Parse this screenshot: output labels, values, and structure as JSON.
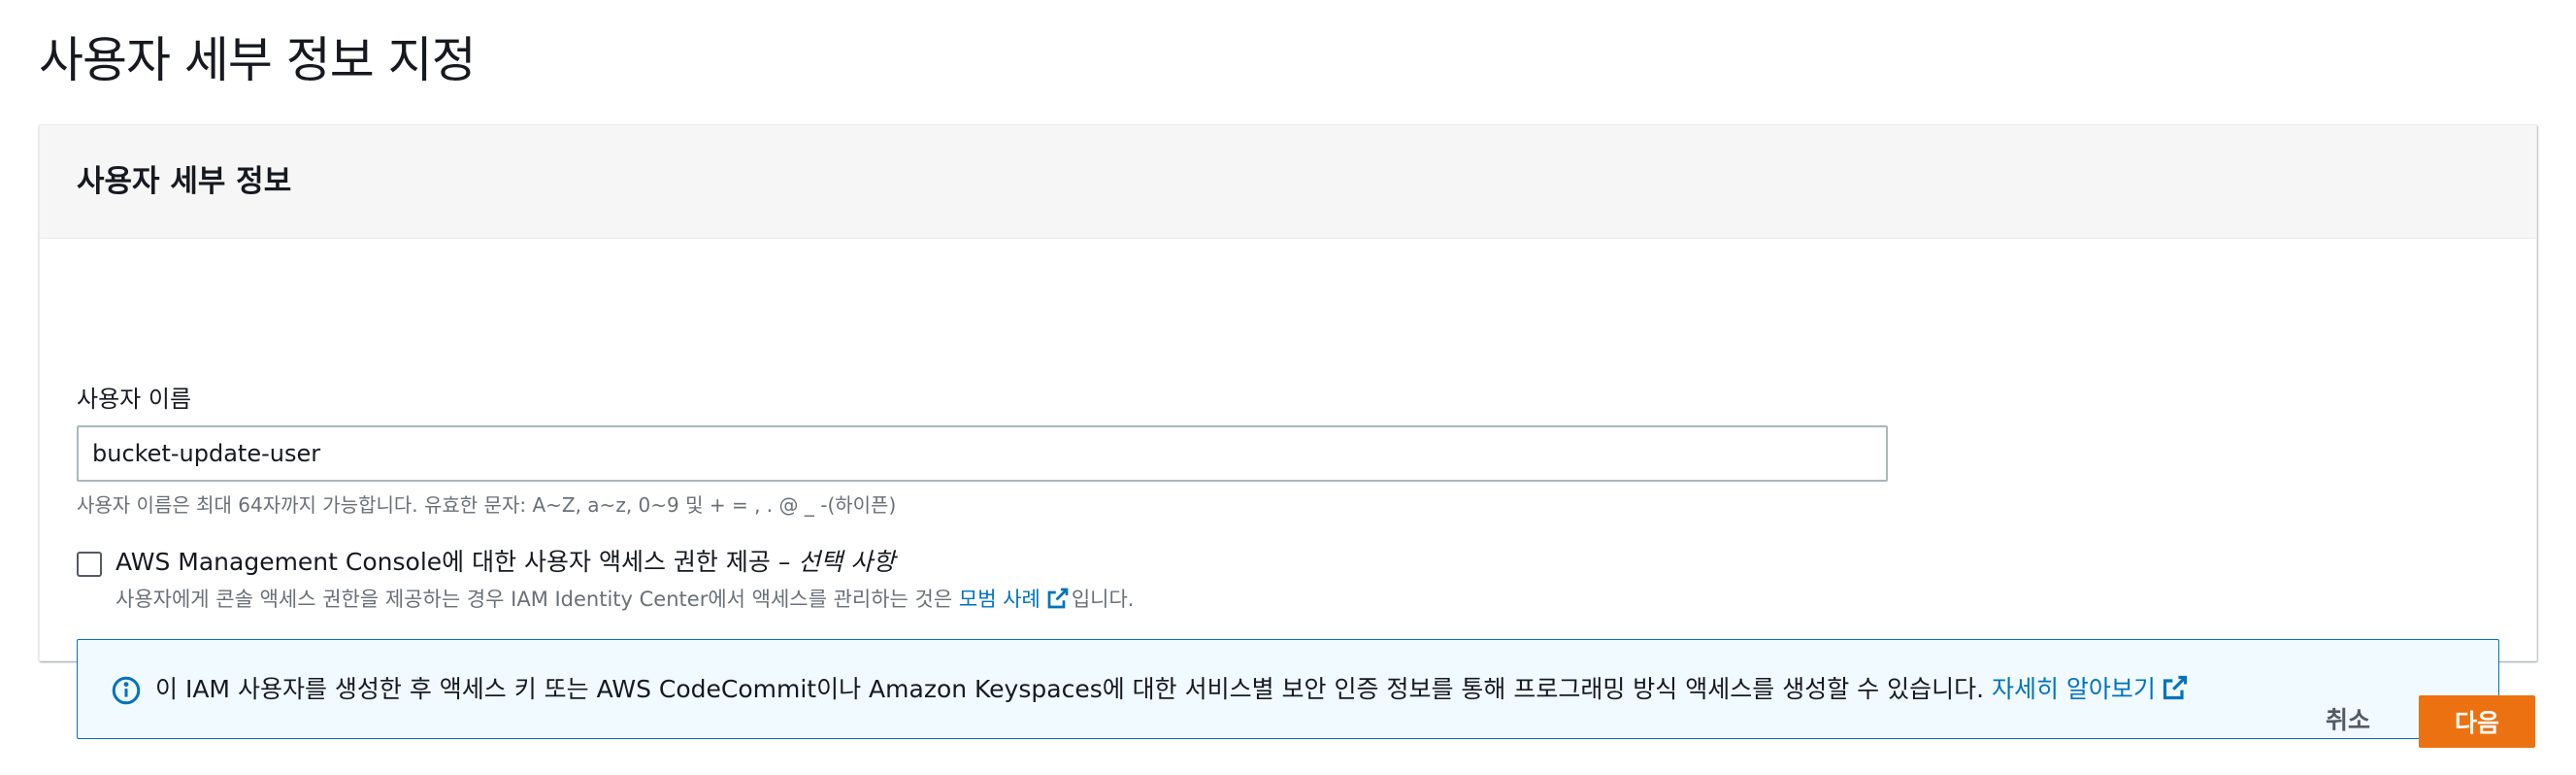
{
  "page": {
    "title": "사용자 세부 정보 지정"
  },
  "section": {
    "title": "사용자 세부 정보"
  },
  "username": {
    "label": "사용자 이름",
    "value": "bucket-update-user",
    "hint": "사용자 이름은 최대 64자까지 가능합니다. 유효한 문자: A~Z, a~z, 0~9 및 + = , . @ _ -(하이픈)"
  },
  "console_access": {
    "checked": false,
    "label": "AWS Management Console에 대한 사용자 액세스 권한 제공 – ",
    "label_optional": "선택 사항",
    "desc_prefix": "사용자에게 콘솔 액세스 권한을 제공하는 경우 IAM Identity Center에서 액세스를 관리하는 것은 ",
    "desc_link": "모범 사례",
    "desc_suffix": "입니다.",
    "link_icon": "external-link-icon"
  },
  "info_alert": {
    "icon": "info-icon",
    "text": "이 IAM 사용자를 생성한 후 액세스 키 또는 AWS CodeCommit이나 Amazon Keyspaces에 대한 서비스별 보안 인증 정보를 통해 프로그래밍 방식 액세스를 생성할 수 있습니다. ",
    "link": "자세히 알아보기",
    "link_icon": "external-link-icon"
  },
  "footer": {
    "cancel_label": "취소",
    "next_label": "다음"
  },
  "colors": {
    "primary_button": "#ec7211",
    "link": "#0073bb",
    "info_border": "#0073bb",
    "info_background": "#f1faff"
  }
}
